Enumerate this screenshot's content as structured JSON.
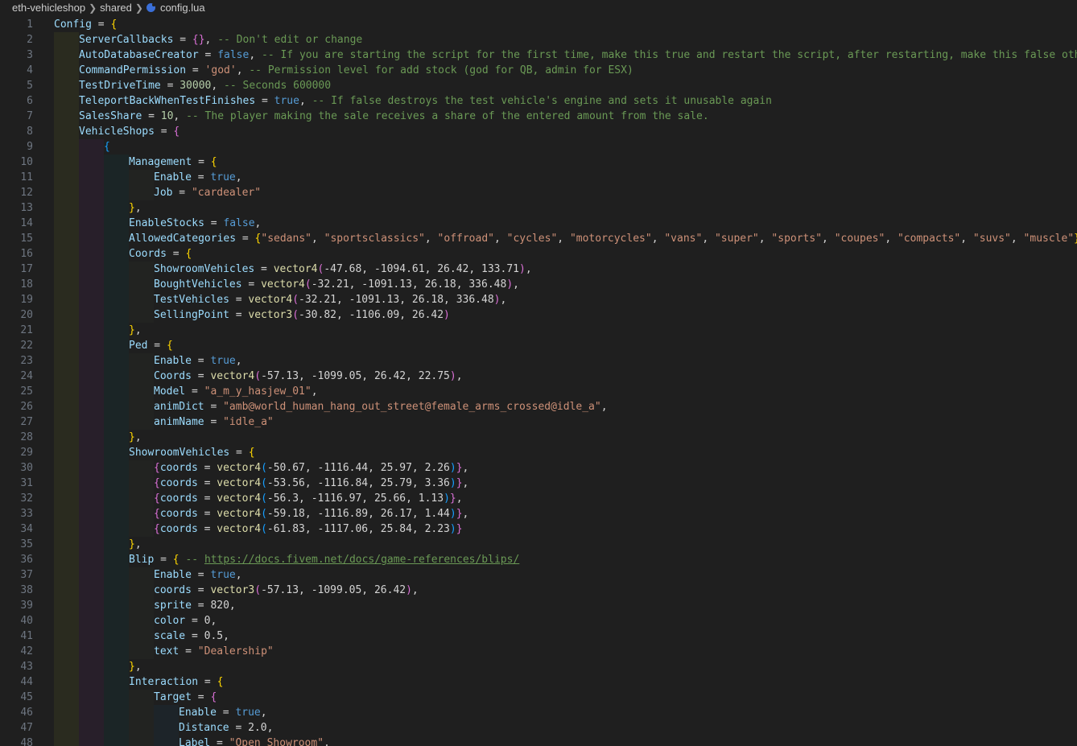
{
  "breadcrumb": [
    "eth-vehicleshop",
    "shared",
    "config.lua"
  ],
  "file_icon": "lua-file-icon",
  "colors": {
    "background": "#1f1f1f",
    "property": "#9cdcfe",
    "operator": "#d4d4d4",
    "bracket_level1": "#ffd700",
    "bracket_level2": "#da70d6",
    "bracket_level3": "#179fff",
    "keyword": "#569cd6",
    "string": "#ce9178",
    "number": "#b5cea8",
    "comment": "#6a9955",
    "function": "#dcdcaa"
  },
  "lines": [
    {
      "n": "1",
      "i": 0,
      "t": [
        [
          "p",
          "Config"
        ],
        [
          "o",
          " = "
        ],
        [
          "b1",
          "{"
        ]
      ]
    },
    {
      "n": "2",
      "i": 1,
      "t": [
        [
          "p",
          "ServerCallbacks"
        ],
        [
          "o",
          " = "
        ],
        [
          "b2",
          "{}"
        ],
        [
          "o",
          ", "
        ],
        [
          "c",
          "-- Don't edit or change"
        ]
      ]
    },
    {
      "n": "3",
      "i": 1,
      "t": [
        [
          "p",
          "AutoDatabaseCreator"
        ],
        [
          "o",
          " = "
        ],
        [
          "kw",
          "false"
        ],
        [
          "o",
          ", "
        ],
        [
          "c",
          "-- If you are starting the script for the first time, make this true and restart the script, after restarting, make this false other"
        ]
      ]
    },
    {
      "n": "4",
      "i": 1,
      "t": [
        [
          "p",
          "CommandPermission"
        ],
        [
          "o",
          " = "
        ],
        [
          "s",
          "'god'"
        ],
        [
          "o",
          ", "
        ],
        [
          "c",
          "-- Permission level for add stock (god for QB, admin for ESX)"
        ]
      ]
    },
    {
      "n": "5",
      "i": 1,
      "t": [
        [
          "p",
          "TestDriveTime"
        ],
        [
          "o",
          " = "
        ],
        [
          "n",
          "30000"
        ],
        [
          "o",
          ", "
        ],
        [
          "c",
          "-- Seconds 600000"
        ]
      ]
    },
    {
      "n": "6",
      "i": 1,
      "t": [
        [
          "p",
          "TeleportBackWhenTestFinishes"
        ],
        [
          "o",
          " = "
        ],
        [
          "kw",
          "true"
        ],
        [
          "o",
          ", "
        ],
        [
          "c",
          "-- If false destroys the test vehicle's engine and sets it unusable again"
        ]
      ]
    },
    {
      "n": "7",
      "i": 1,
      "t": [
        [
          "p",
          "SalesShare"
        ],
        [
          "o",
          " = "
        ],
        [
          "n",
          "10"
        ],
        [
          "o",
          ", "
        ],
        [
          "c",
          "-- The player making the sale receives a share of the entered amount from the sale."
        ]
      ]
    },
    {
      "n": "8",
      "i": 1,
      "t": [
        [
          "p",
          "VehicleShops"
        ],
        [
          "o",
          " = "
        ],
        [
          "b2",
          "{"
        ]
      ]
    },
    {
      "n": "9",
      "i": 2,
      "t": [
        [
          "b3",
          "{"
        ]
      ]
    },
    {
      "n": "10",
      "i": 3,
      "t": [
        [
          "p",
          "Management"
        ],
        [
          "o",
          " = "
        ],
        [
          "b1",
          "{"
        ]
      ]
    },
    {
      "n": "11",
      "i": 4,
      "t": [
        [
          "p",
          "Enable"
        ],
        [
          "o",
          " = "
        ],
        [
          "kw",
          "true"
        ],
        [
          "o",
          ","
        ]
      ]
    },
    {
      "n": "12",
      "i": 4,
      "t": [
        [
          "p",
          "Job"
        ],
        [
          "o",
          " = "
        ],
        [
          "s",
          "\"cardealer\""
        ]
      ]
    },
    {
      "n": "13",
      "i": 3,
      "t": [
        [
          "b1",
          "}"
        ],
        [
          "o",
          ","
        ]
      ]
    },
    {
      "n": "14",
      "i": 3,
      "t": [
        [
          "p",
          "EnableStocks"
        ],
        [
          "o",
          " = "
        ],
        [
          "kw",
          "false"
        ],
        [
          "o",
          ","
        ]
      ]
    },
    {
      "n": "15",
      "i": 3,
      "t": [
        [
          "p",
          "AllowedCategories"
        ],
        [
          "o",
          " = "
        ],
        [
          "b1",
          "{"
        ],
        [
          "s",
          "\"sedans\""
        ],
        [
          "o",
          ", "
        ],
        [
          "s",
          "\"sportsclassics\""
        ],
        [
          "o",
          ", "
        ],
        [
          "s",
          "\"offroad\""
        ],
        [
          "o",
          ", "
        ],
        [
          "s",
          "\"cycles\""
        ],
        [
          "o",
          ", "
        ],
        [
          "s",
          "\"motorcycles\""
        ],
        [
          "o",
          ", "
        ],
        [
          "s",
          "\"vans\""
        ],
        [
          "o",
          ", "
        ],
        [
          "s",
          "\"super\""
        ],
        [
          "o",
          ", "
        ],
        [
          "s",
          "\"sports\""
        ],
        [
          "o",
          ", "
        ],
        [
          "s",
          "\"coupes\""
        ],
        [
          "o",
          ", "
        ],
        [
          "s",
          "\"compacts\""
        ],
        [
          "o",
          ", "
        ],
        [
          "s",
          "\"suvs\""
        ],
        [
          "o",
          ", "
        ],
        [
          "s",
          "\"muscle\""
        ],
        [
          "b1",
          "}"
        ],
        [
          "o",
          ","
        ]
      ]
    },
    {
      "n": "16",
      "i": 3,
      "t": [
        [
          "p",
          "Coords"
        ],
        [
          "o",
          " = "
        ],
        [
          "b1",
          "{"
        ]
      ]
    },
    {
      "n": "17",
      "i": 4,
      "t": [
        [
          "p",
          "ShowroomVehicles"
        ],
        [
          "o",
          " = "
        ],
        [
          "f",
          "vector4"
        ],
        [
          "b2",
          "("
        ],
        [
          "o",
          "-47.68, -1094.61, 26.42, 133.71"
        ],
        [
          "b2",
          ")"
        ],
        [
          "o",
          ","
        ]
      ]
    },
    {
      "n": "18",
      "i": 4,
      "t": [
        [
          "p",
          "BoughtVehicles"
        ],
        [
          "o",
          " = "
        ],
        [
          "f",
          "vector4"
        ],
        [
          "b2",
          "("
        ],
        [
          "o",
          "-32.21, -1091.13, 26.18, 336.48"
        ],
        [
          "b2",
          ")"
        ],
        [
          "o",
          ","
        ]
      ]
    },
    {
      "n": "19",
      "i": 4,
      "t": [
        [
          "p",
          "TestVehicles"
        ],
        [
          "o",
          " = "
        ],
        [
          "f",
          "vector4"
        ],
        [
          "b2",
          "("
        ],
        [
          "o",
          "-32.21, -1091.13, 26.18, 336.48"
        ],
        [
          "b2",
          ")"
        ],
        [
          "o",
          ","
        ]
      ]
    },
    {
      "n": "20",
      "i": 4,
      "t": [
        [
          "p",
          "SellingPoint"
        ],
        [
          "o",
          " = "
        ],
        [
          "f",
          "vector3"
        ],
        [
          "b2",
          "("
        ],
        [
          "o",
          "-30.82, -1106.09, 26.42"
        ],
        [
          "b2",
          ")"
        ]
      ]
    },
    {
      "n": "21",
      "i": 3,
      "t": [
        [
          "b1",
          "}"
        ],
        [
          "o",
          ","
        ]
      ]
    },
    {
      "n": "22",
      "i": 3,
      "t": [
        [
          "p",
          "Ped"
        ],
        [
          "o",
          " = "
        ],
        [
          "b1",
          "{"
        ]
      ]
    },
    {
      "n": "23",
      "i": 4,
      "t": [
        [
          "p",
          "Enable"
        ],
        [
          "o",
          " = "
        ],
        [
          "kw",
          "true"
        ],
        [
          "o",
          ","
        ]
      ]
    },
    {
      "n": "24",
      "i": 4,
      "t": [
        [
          "p",
          "Coords"
        ],
        [
          "o",
          " = "
        ],
        [
          "f",
          "vector4"
        ],
        [
          "b2",
          "("
        ],
        [
          "o",
          "-57.13, -1099.05, 26.42, 22.75"
        ],
        [
          "b2",
          ")"
        ],
        [
          "o",
          ","
        ]
      ]
    },
    {
      "n": "25",
      "i": 4,
      "t": [
        [
          "p",
          "Model"
        ],
        [
          "o",
          " = "
        ],
        [
          "s",
          "\"a_m_y_hasjew_01\""
        ],
        [
          "o",
          ","
        ]
      ]
    },
    {
      "n": "26",
      "i": 4,
      "t": [
        [
          "p",
          "animDict"
        ],
        [
          "o",
          " = "
        ],
        [
          "s",
          "\"amb@world_human_hang_out_street@female_arms_crossed@idle_a\""
        ],
        [
          "o",
          ","
        ]
      ]
    },
    {
      "n": "27",
      "i": 4,
      "t": [
        [
          "p",
          "animName"
        ],
        [
          "o",
          " = "
        ],
        [
          "s",
          "\"idle_a\""
        ]
      ]
    },
    {
      "n": "28",
      "i": 3,
      "t": [
        [
          "b1",
          "}"
        ],
        [
          "o",
          ","
        ]
      ]
    },
    {
      "n": "29",
      "i": 3,
      "t": [
        [
          "p",
          "ShowroomVehicles"
        ],
        [
          "o",
          " = "
        ],
        [
          "b1",
          "{"
        ]
      ]
    },
    {
      "n": "30",
      "i": 4,
      "t": [
        [
          "b2",
          "{"
        ],
        [
          "p",
          "coords"
        ],
        [
          "o",
          " = "
        ],
        [
          "f",
          "vector4"
        ],
        [
          "b3",
          "("
        ],
        [
          "o",
          "-50.67, -1116.44, 25.97, 2.26"
        ],
        [
          "b3",
          ")"
        ],
        [
          "b2",
          "}"
        ],
        [
          "o",
          ","
        ]
      ]
    },
    {
      "n": "31",
      "i": 4,
      "t": [
        [
          "b2",
          "{"
        ],
        [
          "p",
          "coords"
        ],
        [
          "o",
          " = "
        ],
        [
          "f",
          "vector4"
        ],
        [
          "b3",
          "("
        ],
        [
          "o",
          "-53.56, -1116.84, 25.79, 3.36"
        ],
        [
          "b3",
          ")"
        ],
        [
          "b2",
          "}"
        ],
        [
          "o",
          ","
        ]
      ]
    },
    {
      "n": "32",
      "i": 4,
      "t": [
        [
          "b2",
          "{"
        ],
        [
          "p",
          "coords"
        ],
        [
          "o",
          " = "
        ],
        [
          "f",
          "vector4"
        ],
        [
          "b3",
          "("
        ],
        [
          "o",
          "-56.3, -1116.97, 25.66, 1.13"
        ],
        [
          "b3",
          ")"
        ],
        [
          "b2",
          "}"
        ],
        [
          "o",
          ","
        ]
      ]
    },
    {
      "n": "33",
      "i": 4,
      "t": [
        [
          "b2",
          "{"
        ],
        [
          "p",
          "coords"
        ],
        [
          "o",
          " = "
        ],
        [
          "f",
          "vector4"
        ],
        [
          "b3",
          "("
        ],
        [
          "o",
          "-59.18, -1116.89, 26.17, 1.44"
        ],
        [
          "b3",
          ")"
        ],
        [
          "b2",
          "}"
        ],
        [
          "o",
          ","
        ]
      ]
    },
    {
      "n": "34",
      "i": 4,
      "t": [
        [
          "b2",
          "{"
        ],
        [
          "p",
          "coords"
        ],
        [
          "o",
          " = "
        ],
        [
          "f",
          "vector4"
        ],
        [
          "b3",
          "("
        ],
        [
          "o",
          "-61.83, -1117.06, 25.84, 2.23"
        ],
        [
          "b3",
          ")"
        ],
        [
          "b2",
          "}"
        ]
      ]
    },
    {
      "n": "35",
      "i": 3,
      "t": [
        [
          "b1",
          "}"
        ],
        [
          "o",
          ","
        ]
      ]
    },
    {
      "n": "36",
      "i": 3,
      "t": [
        [
          "p",
          "Blip"
        ],
        [
          "o",
          " = "
        ],
        [
          "b1",
          "{"
        ],
        [
          "o",
          " "
        ],
        [
          "c",
          "-- "
        ],
        [
          "u",
          "https://docs.fivem.net/docs/game-references/blips/"
        ]
      ]
    },
    {
      "n": "37",
      "i": 4,
      "t": [
        [
          "p",
          "Enable"
        ],
        [
          "o",
          " = "
        ],
        [
          "kw",
          "true"
        ],
        [
          "o",
          ","
        ]
      ]
    },
    {
      "n": "38",
      "i": 4,
      "t": [
        [
          "p",
          "coords"
        ],
        [
          "o",
          " = "
        ],
        [
          "f",
          "vector3"
        ],
        [
          "b2",
          "("
        ],
        [
          "o",
          "-57.13, -1099.05, 26.42"
        ],
        [
          "b2",
          ")"
        ],
        [
          "o",
          ","
        ]
      ]
    },
    {
      "n": "39",
      "i": 4,
      "t": [
        [
          "p",
          "sprite"
        ],
        [
          "o",
          " = 820,"
        ]
      ]
    },
    {
      "n": "40",
      "i": 4,
      "t": [
        [
          "p",
          "color"
        ],
        [
          "o",
          " = 0,"
        ]
      ]
    },
    {
      "n": "41",
      "i": 4,
      "t": [
        [
          "p",
          "scale"
        ],
        [
          "o",
          " = 0.5,"
        ]
      ]
    },
    {
      "n": "42",
      "i": 4,
      "t": [
        [
          "p",
          "text"
        ],
        [
          "o",
          " = "
        ],
        [
          "s",
          "\"Dealership\""
        ]
      ]
    },
    {
      "n": "43",
      "i": 3,
      "t": [
        [
          "b1",
          "}"
        ],
        [
          "o",
          ","
        ]
      ]
    },
    {
      "n": "44",
      "i": 3,
      "t": [
        [
          "p",
          "Interaction"
        ],
        [
          "o",
          " = "
        ],
        [
          "b1",
          "{"
        ]
      ]
    },
    {
      "n": "45",
      "i": 4,
      "t": [
        [
          "p",
          "Target"
        ],
        [
          "o",
          " = "
        ],
        [
          "b2",
          "{"
        ]
      ]
    },
    {
      "n": "46",
      "i": 5,
      "t": [
        [
          "p",
          "Enable"
        ],
        [
          "o",
          " = "
        ],
        [
          "kw",
          "true"
        ],
        [
          "o",
          ","
        ]
      ]
    },
    {
      "n": "47",
      "i": 5,
      "t": [
        [
          "p",
          "Distance"
        ],
        [
          "o",
          " = 2.0,"
        ]
      ]
    },
    {
      "n": "48",
      "i": 5,
      "t": [
        [
          "p",
          "Label"
        ],
        [
          "o",
          " = "
        ],
        [
          "s",
          "\"Open Showroom\""
        ],
        [
          "o",
          ","
        ]
      ]
    }
  ]
}
